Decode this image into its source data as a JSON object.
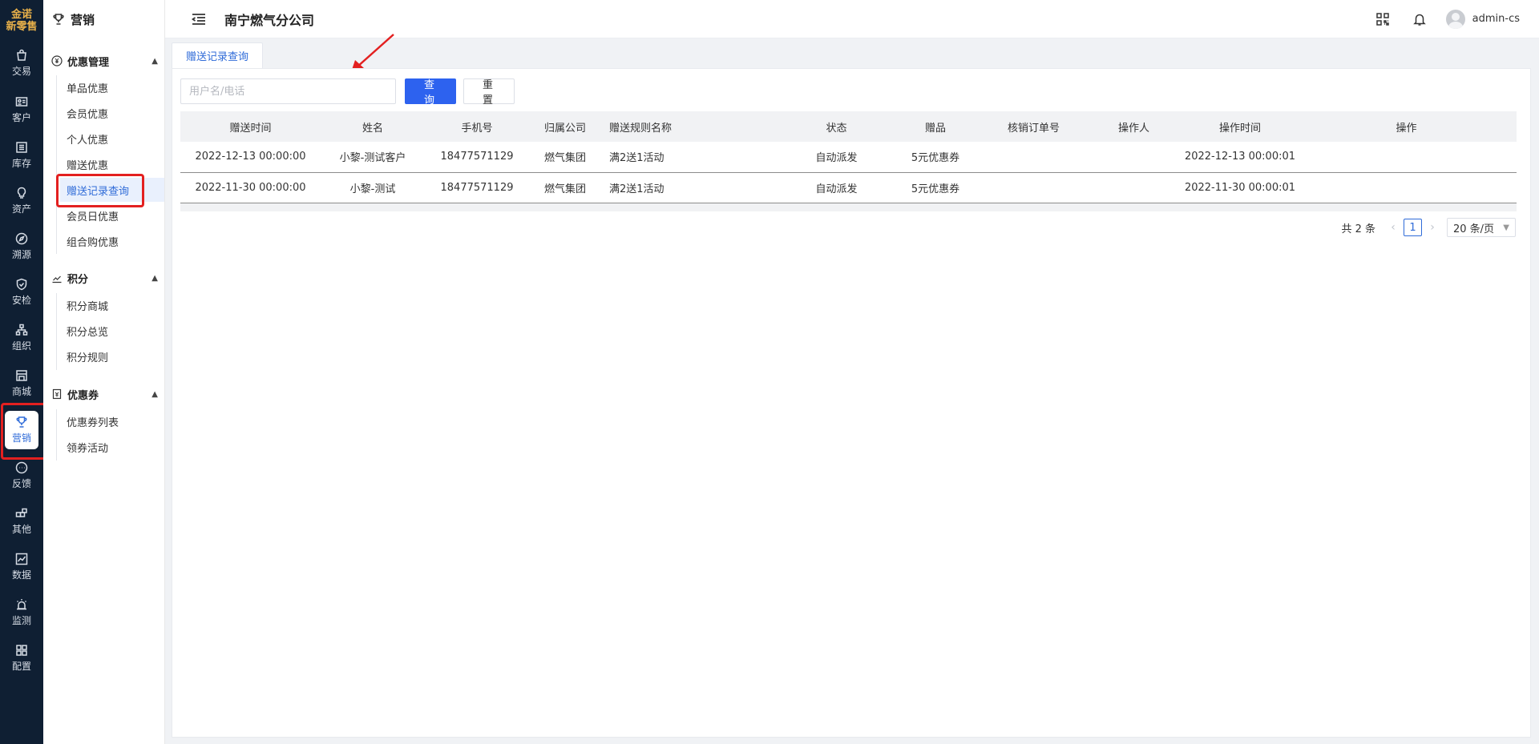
{
  "rail": {
    "brand": "金诺",
    "brand_sub": "新零售",
    "items": [
      {
        "label": "交易",
        "icon": "bag-icon"
      },
      {
        "label": "客户",
        "icon": "id-card-icon"
      },
      {
        "label": "库存",
        "icon": "list-icon"
      },
      {
        "label": "资产",
        "icon": "bulb-icon"
      },
      {
        "label": "溯源",
        "icon": "compass-icon"
      },
      {
        "label": "安检",
        "icon": "shield-check-icon"
      },
      {
        "label": "组织",
        "icon": "org-chart-icon"
      },
      {
        "label": "商城",
        "icon": "store-icon"
      },
      {
        "label": "营销",
        "icon": "trophy-icon",
        "active": true
      },
      {
        "label": "反馈",
        "icon": "chat-icon"
      },
      {
        "label": "其他",
        "icon": "blocks-icon"
      },
      {
        "label": "数据",
        "icon": "line-chart-icon"
      },
      {
        "label": "监测",
        "icon": "alarm-icon"
      },
      {
        "label": "配置",
        "icon": "grid-icon"
      }
    ]
  },
  "subnav": {
    "title": "营销",
    "groups": [
      {
        "title": "优惠管理",
        "items": [
          "单品优惠",
          "会员优惠",
          "个人优惠",
          "赠送优惠",
          "赠送记录查询",
          "会员日优惠",
          "组合购优惠"
        ]
      },
      {
        "title": "积分",
        "items": [
          "积分商城",
          "积分总览",
          "积分规则"
        ]
      },
      {
        "title": "优惠券",
        "items": [
          "优惠券列表",
          "领券活动"
        ]
      }
    ]
  },
  "header": {
    "company": "南宁燃气分公司",
    "username": "admin-cs"
  },
  "tabs": [
    {
      "label": "赠送记录查询"
    }
  ],
  "filter": {
    "placeholder": "用户名/电话",
    "query_label": "查询",
    "reset_label": "重置"
  },
  "table": {
    "columns": [
      "赠送时间",
      "姓名",
      "手机号",
      "归属公司",
      "赠送规则名称",
      "状态",
      "赠品",
      "核销订单号",
      "操作人",
      "操作时间",
      "操作"
    ],
    "rows": [
      [
        "2022-12-13 00:00:00",
        "小黎-测试客户",
        "18477571129",
        "燃气集团",
        "满2送1活动",
        "自动派发",
        "5元优惠券",
        "",
        "",
        "2022-12-13 00:00:01",
        ""
      ],
      [
        "2022-11-30 00:00:00",
        "小黎-测试",
        "18477571129",
        "燃气集团",
        "满2送1活动",
        "自动派发",
        "5元优惠券",
        "",
        "",
        "2022-11-30 00:00:01",
        ""
      ]
    ]
  },
  "pagination": {
    "total_text": "共 2 条",
    "current_page": "1",
    "page_size": "20 条/页"
  },
  "colors": {
    "accent": "#2f6bd8",
    "primary_button": "#2d62ef",
    "rail_bg": "#0f1f33",
    "annotation": "#e32020"
  }
}
